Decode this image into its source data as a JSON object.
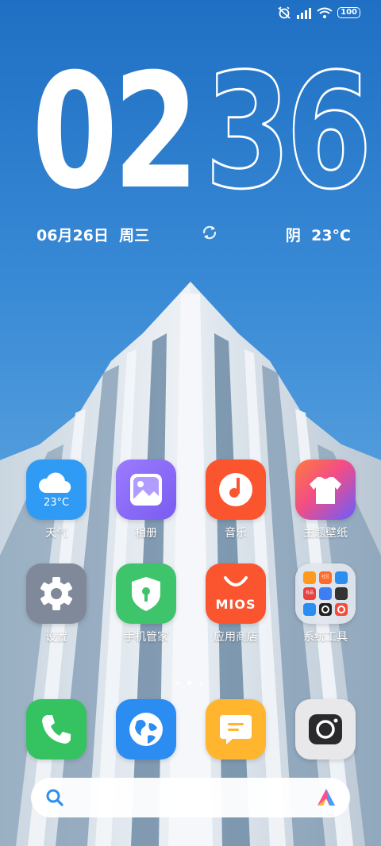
{
  "status_bar": {
    "battery": "100",
    "icons": [
      "alarm-off-icon",
      "signal-icon",
      "wifi-icon",
      "battery-icon"
    ]
  },
  "clock": {
    "hour": "02",
    "minute": "36"
  },
  "date": "06月26日  周三",
  "weather": "阴  23°C",
  "apps": [
    {
      "label": "天气",
      "icon": "weather-icon",
      "icon_text": "23°C",
      "color": "#2f9bf5"
    },
    {
      "label": "相册",
      "icon": "gallery-icon",
      "color": "#8b6cf5"
    },
    {
      "label": "音乐",
      "icon": "music-icon",
      "color": "#fb5530"
    },
    {
      "label": "主题壁纸",
      "icon": "themes-icon",
      "color": "#f24d86"
    },
    {
      "label": "设置",
      "icon": "settings-icon",
      "color": "#7f8999"
    },
    {
      "label": "手机管家",
      "icon": "security-icon",
      "color": "#3ec46b"
    },
    {
      "label": "应用商店",
      "icon": "app-store-icon",
      "icon_text": "MIOS",
      "color": "#fb5530"
    },
    {
      "label": "系统工具",
      "icon": "folder-icon",
      "folder_badges": [
        "社区",
        "有品"
      ],
      "color": "#dfe3ea"
    }
  ],
  "dock": [
    {
      "icon": "phone-icon",
      "color": "#35c260"
    },
    {
      "icon": "browser-icon",
      "color": "#2b8cf2"
    },
    {
      "icon": "messages-icon",
      "color": "#ffb62e"
    },
    {
      "icon": "camera-icon",
      "color": "#e8e8ea"
    }
  ],
  "search": {
    "left_icon": "search-icon",
    "right_icon": "assistant-icon"
  }
}
